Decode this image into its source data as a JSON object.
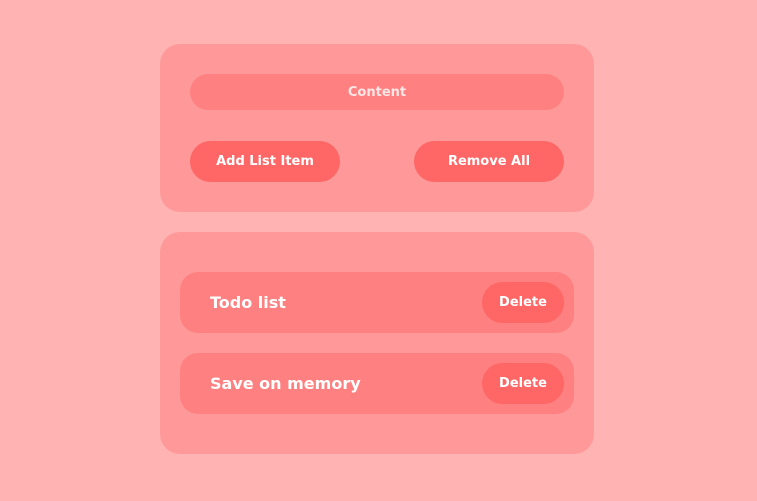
{
  "colors": {
    "background": "#ffb3b3",
    "panel": "#ff9999",
    "input": "#ff8080",
    "button": "#ff6666",
    "text": "#ffffff"
  },
  "form": {
    "content_placeholder": "Content",
    "content_value": "",
    "add_label": "Add List Item",
    "remove_all_label": "Remove All"
  },
  "list": {
    "items": [
      {
        "label": "Todo list",
        "delete_label": "Delete"
      },
      {
        "label": "Save on memory",
        "delete_label": "Delete"
      }
    ]
  }
}
